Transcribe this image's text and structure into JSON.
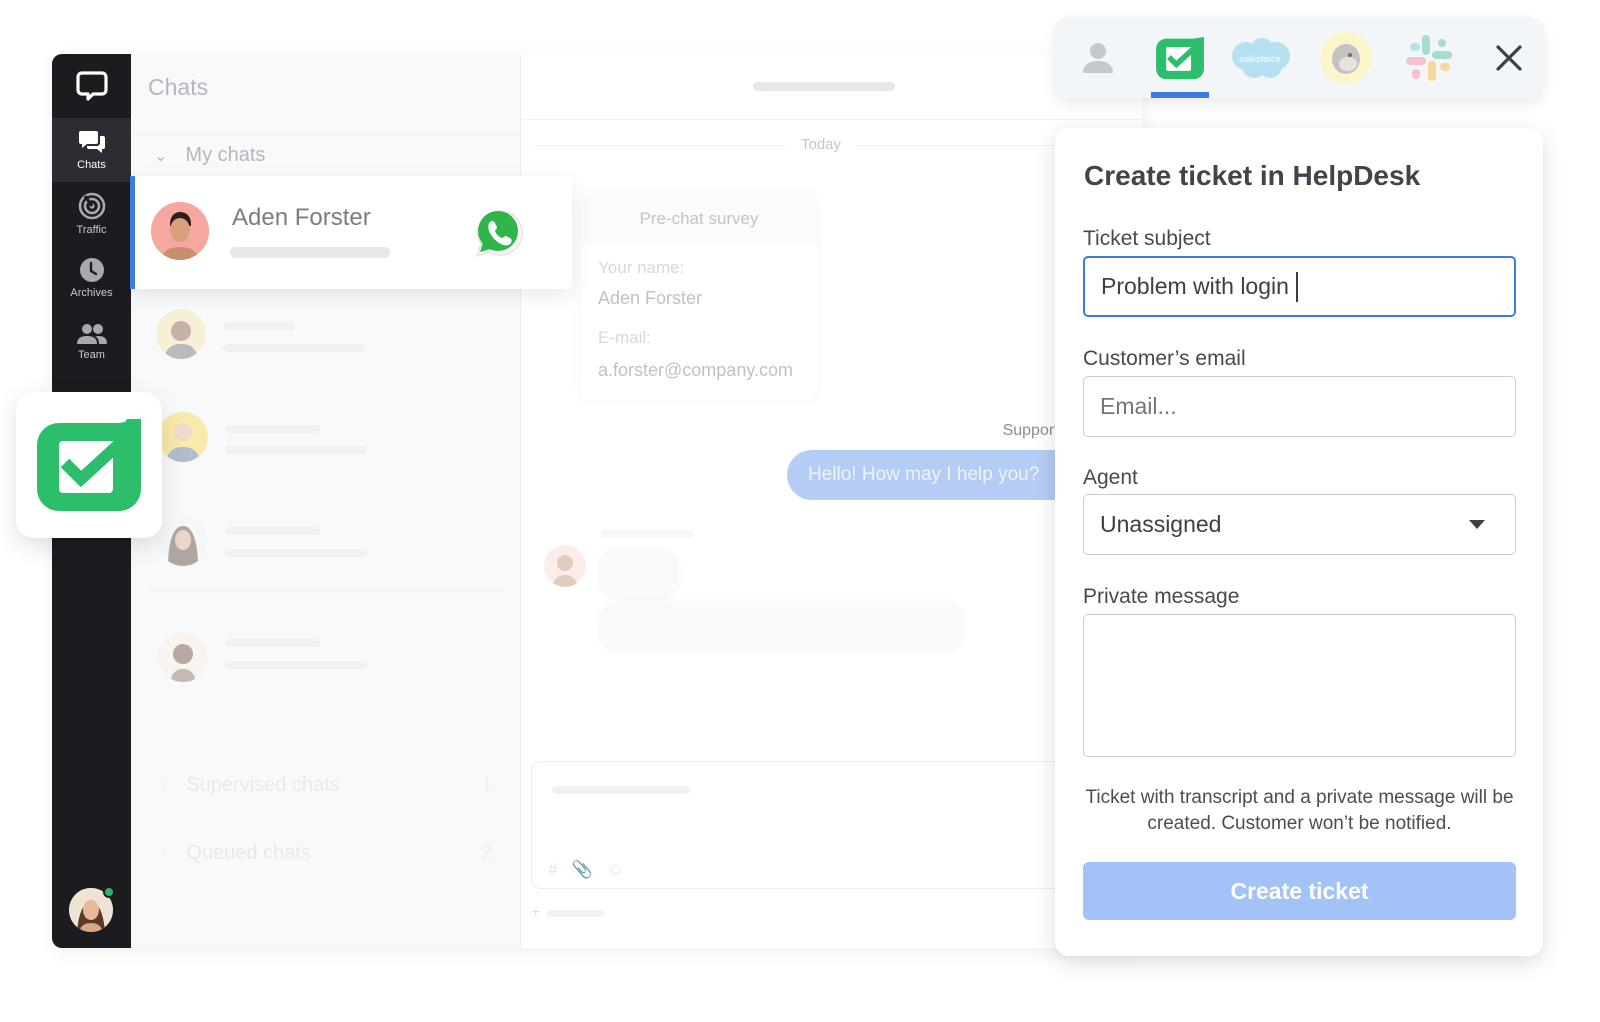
{
  "sidebar": {
    "logo_icon": "chat-bubble-logo",
    "items": [
      {
        "label": "Chats",
        "icon": "chats-icon",
        "active": true
      },
      {
        "label": "Traffic",
        "icon": "traffic-icon",
        "active": false
      },
      {
        "label": "Archives",
        "icon": "clock-icon",
        "active": false
      },
      {
        "label": "Team",
        "icon": "team-icon",
        "active": false
      }
    ],
    "user_status": "online"
  },
  "chat_list": {
    "title": "Chats",
    "section": "My chats",
    "active_chat": {
      "name": "Aden Forster",
      "channel_icon": "whatsapp-icon"
    },
    "groups": [
      {
        "label": "Supervised chats",
        "count": "1"
      },
      {
        "label": "Queued chats",
        "count": "2"
      }
    ]
  },
  "conversation": {
    "date_separator": "Today",
    "survey": {
      "title": "Pre-chat survey",
      "fields": [
        {
          "label": "Your name:",
          "value": "Aden Forster"
        },
        {
          "label": "E-mail:",
          "value": "a.forster@company.com"
        }
      ]
    },
    "agent_label": "Support Agent",
    "agent_message": "Hello! How may I help you?",
    "composer_tools": [
      "#",
      "attach",
      "emoji"
    ],
    "composer_add": "+"
  },
  "integrations": {
    "tabs": [
      {
        "name": "customer-details",
        "icon": "person-icon",
        "active": false
      },
      {
        "name": "helpdesk",
        "icon": "helpdesk-check-icon",
        "active": true
      },
      {
        "name": "salesforce",
        "icon": "salesforce-icon",
        "label": "salesforce",
        "active": false
      },
      {
        "name": "mailchimp",
        "icon": "mailchimp-icon",
        "active": false
      },
      {
        "name": "slack",
        "icon": "slack-icon",
        "active": false
      }
    ],
    "close_icon": "close-icon",
    "accent": "#3e7ae3"
  },
  "ticket_form": {
    "title": "Create ticket in HelpDesk",
    "subject_label": "Ticket subject",
    "subject_value": "Problem with login",
    "email_label": "Customer’s email",
    "email_placeholder": "Email...",
    "agent_label": "Agent",
    "agent_value": "Unassigned",
    "message_label": "Private message",
    "message_value": "",
    "note": "Ticket with transcript and a private message will be created. Customer won’t be notified.",
    "submit_label": "Create ticket",
    "submit_color": "#a3c2f5"
  }
}
